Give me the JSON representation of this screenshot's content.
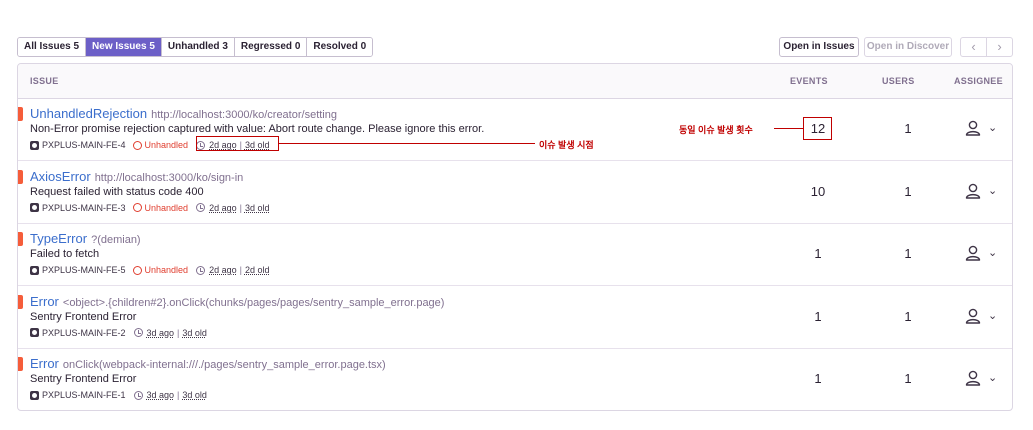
{
  "tabs": [
    {
      "label": "All Issues",
      "count": "5"
    },
    {
      "label": "New Issues",
      "count": "5"
    },
    {
      "label": "Unhandled",
      "count": "3"
    },
    {
      "label": "Regressed",
      "count": "0"
    },
    {
      "label": "Resolved",
      "count": "0"
    }
  ],
  "active_tab": "New Issues",
  "buttons": {
    "open_issues": "Open in Issues",
    "open_discover": "Open in Discover",
    "prev": "‹",
    "next": "›"
  },
  "columns": {
    "issue": "ISSUE",
    "events": "EVENTS",
    "users": "USERS",
    "assignee": "ASSIGNEE"
  },
  "colors": {
    "accent": "#6c5fc7",
    "level": "#f55d3a",
    "link": "#3b6ecc",
    "unhandled": "#e03e2f",
    "annotation": "#c00000"
  },
  "rows": [
    {
      "type": "UnhandledRejection",
      "location": "http://localhost:3000/ko/creator/setting",
      "message": "Non-Error promise rejection captured with value: Abort route change. Please ignore this error.",
      "project": "PXPLUS-MAIN-FE-4",
      "unhandled": "Unhandled",
      "ago": "2d ago",
      "age": "3d old",
      "events": "12",
      "users": "1"
    },
    {
      "type": "AxiosError",
      "location": "http://localhost:3000/ko/sign-in",
      "message": "Request failed with status code 400",
      "project": "PXPLUS-MAIN-FE-3",
      "unhandled": "Unhandled",
      "ago": "2d ago",
      "age": "3d old",
      "events": "10",
      "users": "1"
    },
    {
      "type": "TypeError",
      "location": "?(demian)",
      "message": "Failed to fetch",
      "project": "PXPLUS-MAIN-FE-5",
      "unhandled": "Unhandled",
      "ago": "2d ago",
      "age": "2d old",
      "events": "1",
      "users": "1"
    },
    {
      "type": "Error",
      "location": "<object>.{children#2}.onClick(chunks/pages/pages/sentry_sample_error.page)",
      "message": "Sentry Frontend Error",
      "project": "PXPLUS-MAIN-FE-2",
      "unhandled": "",
      "ago": "3d ago",
      "age": "3d old",
      "events": "1",
      "users": "1"
    },
    {
      "type": "Error",
      "location": "onClick(webpack-internal:///./pages/sentry_sample_error.page.tsx)",
      "message": "Sentry Frontend Error",
      "project": "PXPLUS-MAIN-FE-1",
      "unhandled": "",
      "ago": "3d ago",
      "age": "3d old",
      "events": "1",
      "users": "1"
    }
  ],
  "annotations": {
    "event_count": "동일 이슈 발생 횟수",
    "occurred_time": "이슈 발생 시점"
  }
}
